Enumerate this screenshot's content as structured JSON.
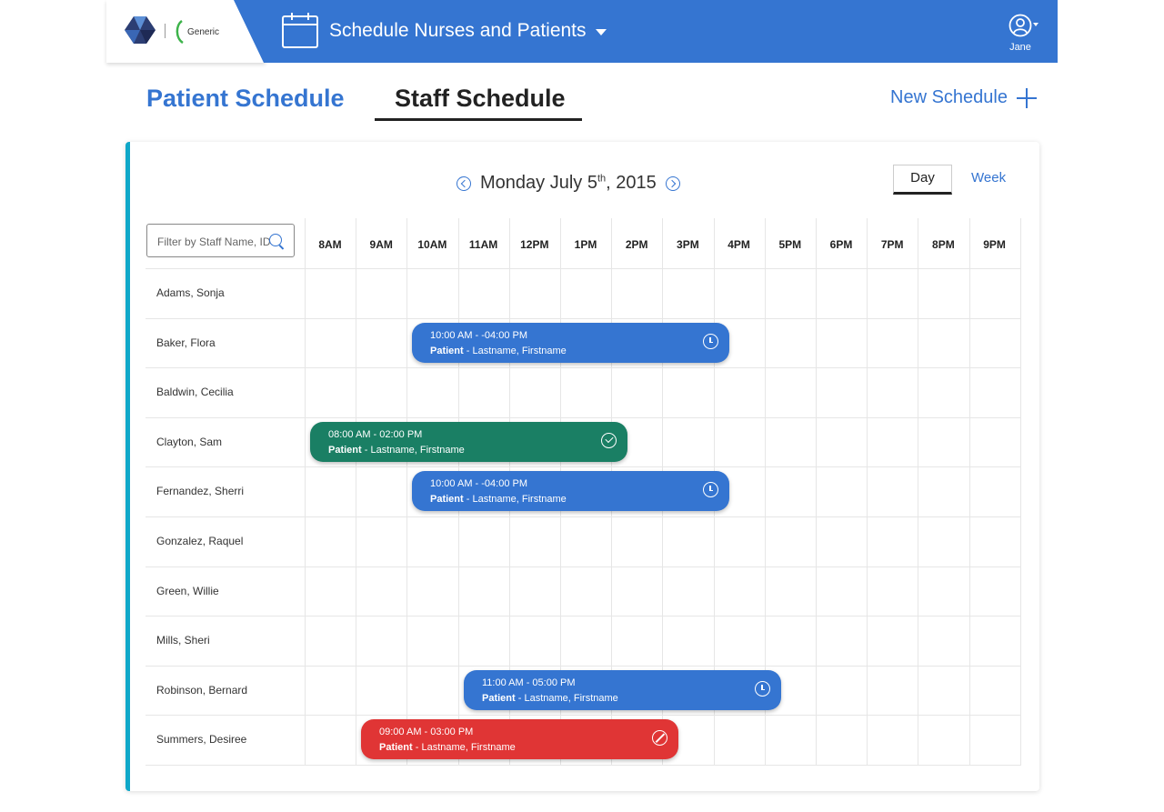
{
  "header": {
    "app_title": "Schedule Nurses and Patients",
    "brand_text": "Generic",
    "user_name": "Jane",
    "accent_color": "#3575d1"
  },
  "tabs": [
    {
      "label": "Patient Schedule",
      "active": false
    },
    {
      "label": "Staff Schedule",
      "active": true
    }
  ],
  "new_schedule_label": "New Schedule",
  "date_nav": {
    "weekday_month_day": "Monday July 5",
    "suffix": "th",
    "year_part": ", 2015"
  },
  "view_toggle": {
    "day": "Day",
    "week": "Week",
    "selected": "Day"
  },
  "filter": {
    "placeholder": "Filter by Staff Name, ID",
    "value": ""
  },
  "hours": [
    "8AM",
    "9AM",
    "10AM",
    "11AM",
    "12PM",
    "1PM",
    "2PM",
    "3PM",
    "4PM",
    "5PM",
    "6PM",
    "7PM",
    "8PM",
    "9PM"
  ],
  "staff": [
    "Adams, Sonja",
    "Baker, Flora",
    "Baldwin, Cecilia",
    "Clayton, Sam",
    "Fernandez, Sherri",
    "Gonzalez, Raquel",
    "Green, Willie",
    "Mills, Sheri",
    "Robinson, Bernard",
    "Summers, Desiree"
  ],
  "events": [
    {
      "staff": "Baker, Flora",
      "time": "10:00 AM - -04:00 PM",
      "label": "Patient",
      "name": " - Lastname, Firstname",
      "status": "scheduled",
      "icon": "clock-icon",
      "color": "#3575d1"
    },
    {
      "staff": "Clayton, Sam",
      "time": "08:00 AM - 02:00 PM",
      "label": "Patient",
      "name": " - Lastname, Firstname",
      "status": "completed",
      "icon": "check-circle-icon",
      "color": "#1a7f64"
    },
    {
      "staff": "Fernandez, Sherri",
      "time": "10:00 AM - -04:00 PM",
      "label": "Patient",
      "name": " - Lastname, Firstname",
      "status": "scheduled",
      "icon": "clock-icon",
      "color": "#3575d1"
    },
    {
      "staff": "Robinson, Bernard",
      "time": "11:00 AM - 05:00 PM",
      "label": "Patient",
      "name": " - Lastname, Firstname",
      "status": "scheduled",
      "icon": "clock-icon",
      "color": "#3575d1"
    },
    {
      "staff": "Summers, Desiree",
      "time": "09:00 AM - 03:00 PM",
      "label": "Patient",
      "name": " - Lastname, Firstname",
      "status": "cancelled",
      "icon": "blocked-icon",
      "color": "#e03535"
    }
  ]
}
